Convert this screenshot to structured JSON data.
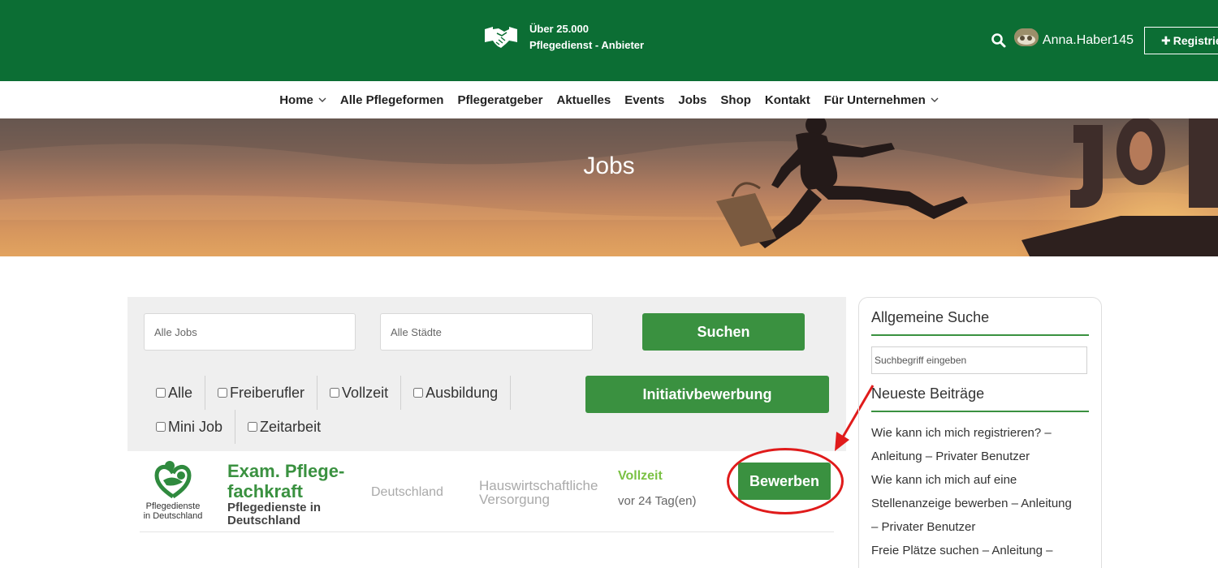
{
  "header": {
    "tagline_line1": "Über 25.000",
    "tagline_line2": "Pflegedienst - Anbieter",
    "username": "Anna.Haber145",
    "register_label": "Registrieren",
    "brand_color": "#0c6e34"
  },
  "nav": {
    "items": [
      {
        "label": "Home",
        "has_dropdown": true
      },
      {
        "label": "Alle Pflegeformen",
        "has_dropdown": false
      },
      {
        "label": "Pflegeratgeber",
        "has_dropdown": false
      },
      {
        "label": "Aktuelles",
        "has_dropdown": false
      },
      {
        "label": "Events",
        "has_dropdown": false
      },
      {
        "label": "Jobs",
        "has_dropdown": false
      },
      {
        "label": "Shop",
        "has_dropdown": false
      },
      {
        "label": "Kontakt",
        "has_dropdown": false
      },
      {
        "label": "Für Unternehmen",
        "has_dropdown": true
      }
    ]
  },
  "hero": {
    "title": "Jobs"
  },
  "job_search": {
    "jobs_placeholder": "Alle Jobs",
    "cities_placeholder": "Alle Städte",
    "search_label": "Suchen",
    "initiative_label": "Initiativbewerbung",
    "filters": [
      "Alle",
      "Freiberufler",
      "Vollzeit",
      "Ausbildung",
      "Mini Job",
      "Zeitarbeit"
    ]
  },
  "job": {
    "logo_text_line1": "Pflegedienste",
    "logo_text_line2": "in Deutschland",
    "title_line1": "Exam. Pflege-",
    "title_line2": "fachkraft",
    "company_line1": "Pflegedienste in",
    "company_line2": "Deutschland",
    "location": "Deutschland",
    "category_line1": "Hauswirtschaftliche",
    "category_line2": "Versorgung",
    "type": "Vollzeit",
    "age": "vor 24 Tag(en)",
    "apply_label": "Bewerben",
    "accent_color": "#3a9140",
    "type_color": "#7ac143",
    "highlight_color": "#e01b1b"
  },
  "sidebar": {
    "general_search_title": "Allgemeine Suche",
    "search_placeholder": "Suchbegriff eingeben",
    "recent_posts_title": "Neueste Beiträge",
    "posts": [
      "Wie kann ich mich registrieren? –",
      "Anleitung – Privater Benutzer",
      "Wie kann ich mich auf eine",
      "Stellenanzeige bewerben – Anleitung",
      "– Privater Benutzer",
      "Freie Plätze suchen – Anleitung –"
    ]
  }
}
